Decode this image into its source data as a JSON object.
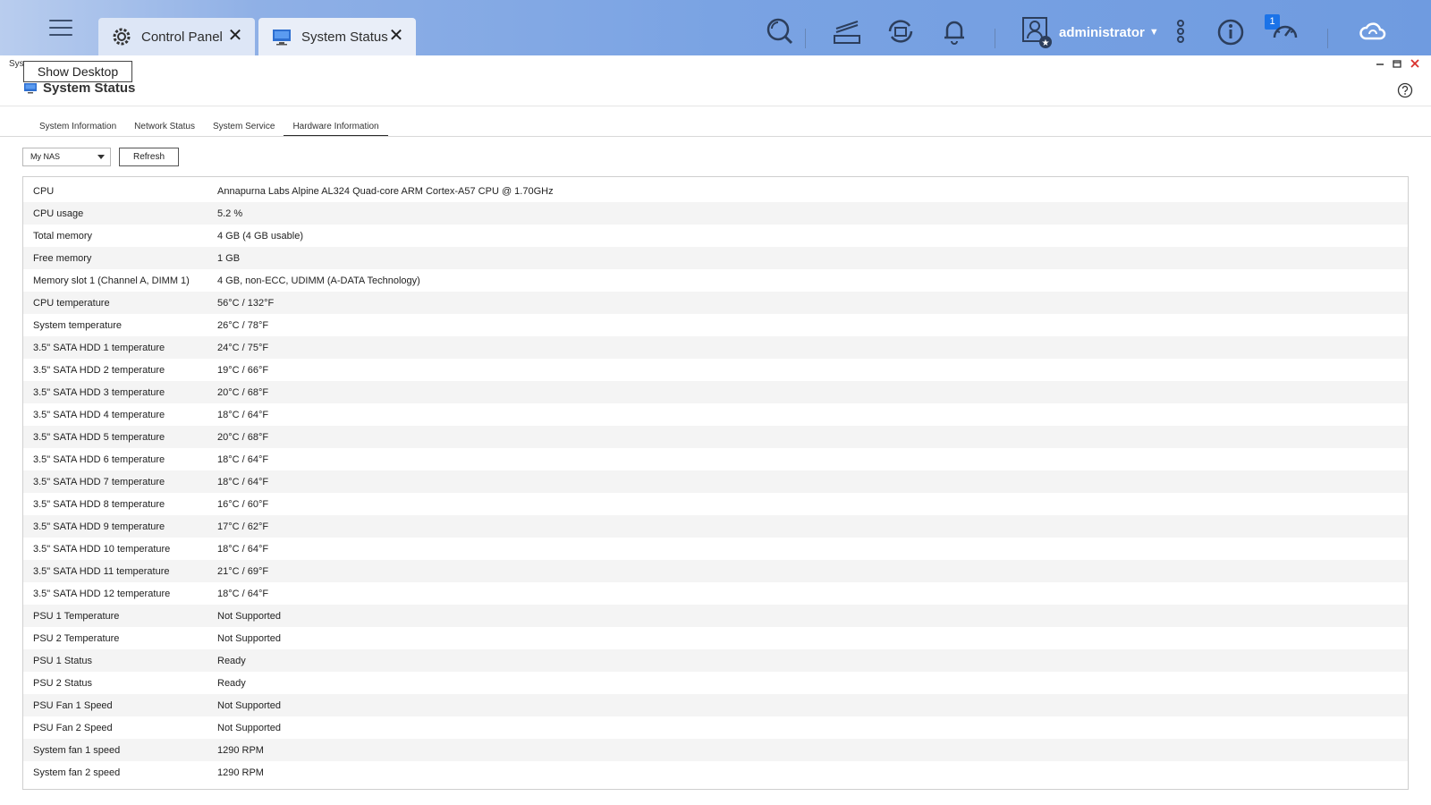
{
  "taskbar": {
    "tabs": [
      {
        "label": "Control Panel"
      },
      {
        "label": "System Status"
      }
    ],
    "user": {
      "name": "administrator"
    },
    "notification_badge": "1"
  },
  "window": {
    "small_title": "Sys",
    "tooltip": "Show Desktop",
    "title": "System Status"
  },
  "subtabs": [
    "System Information",
    "Network Status",
    "System Service",
    "Hardware Information"
  ],
  "toolbar": {
    "device_select": "My NAS",
    "refresh_label": "Refresh"
  },
  "hardware_info": [
    {
      "key": "CPU",
      "value": "Annapurna Labs Alpine AL324 Quad-core ARM Cortex-A57 CPU @ 1.70GHz"
    },
    {
      "key": "CPU usage",
      "value": "5.2 %"
    },
    {
      "key": "Total memory",
      "value": "4 GB (4 GB usable)"
    },
    {
      "key": "Free memory",
      "value": "1 GB"
    },
    {
      "key": "Memory slot 1 (Channel A, DIMM 1)",
      "value": "4 GB, non-ECC, UDIMM (A-DATA Technology)"
    },
    {
      "key": "CPU temperature",
      "value": "56°C / 132°F"
    },
    {
      "key": "System temperature",
      "value": "26°C / 78°F"
    },
    {
      "key": "3.5\" SATA HDD 1 temperature",
      "value": "24°C / 75°F"
    },
    {
      "key": "3.5\" SATA HDD 2 temperature",
      "value": "19°C / 66°F"
    },
    {
      "key": "3.5\" SATA HDD 3 temperature",
      "value": "20°C / 68°F"
    },
    {
      "key": "3.5\" SATA HDD 4 temperature",
      "value": "18°C / 64°F"
    },
    {
      "key": "3.5\" SATA HDD 5 temperature",
      "value": "20°C / 68°F"
    },
    {
      "key": "3.5\" SATA HDD 6 temperature",
      "value": "18°C / 64°F"
    },
    {
      "key": "3.5\" SATA HDD 7 temperature",
      "value": "18°C / 64°F"
    },
    {
      "key": "3.5\" SATA HDD 8 temperature",
      "value": "16°C / 60°F"
    },
    {
      "key": "3.5\" SATA HDD 9 temperature",
      "value": "17°C / 62°F"
    },
    {
      "key": "3.5\" SATA HDD 10 temperature",
      "value": "18°C / 64°F"
    },
    {
      "key": "3.5\" SATA HDD 11 temperature",
      "value": "21°C / 69°F"
    },
    {
      "key": "3.5\" SATA HDD 12 temperature",
      "value": "18°C / 64°F"
    },
    {
      "key": "PSU 1 Temperature",
      "value": "Not Supported"
    },
    {
      "key": "PSU 2 Temperature",
      "value": "Not Supported"
    },
    {
      "key": "PSU 1 Status",
      "value": "Ready"
    },
    {
      "key": "PSU 2 Status",
      "value": "Ready"
    },
    {
      "key": "PSU Fan 1 Speed",
      "value": "Not Supported"
    },
    {
      "key": "PSU Fan 2 Speed",
      "value": "Not Supported"
    },
    {
      "key": "System fan 1 speed",
      "value": "1290 RPM"
    },
    {
      "key": "System fan 2 speed",
      "value": "1290 RPM"
    }
  ],
  "colors": {
    "accent": "#1b73e8",
    "close_red": "#d9302c",
    "taskbar": "#7aa3e3"
  }
}
